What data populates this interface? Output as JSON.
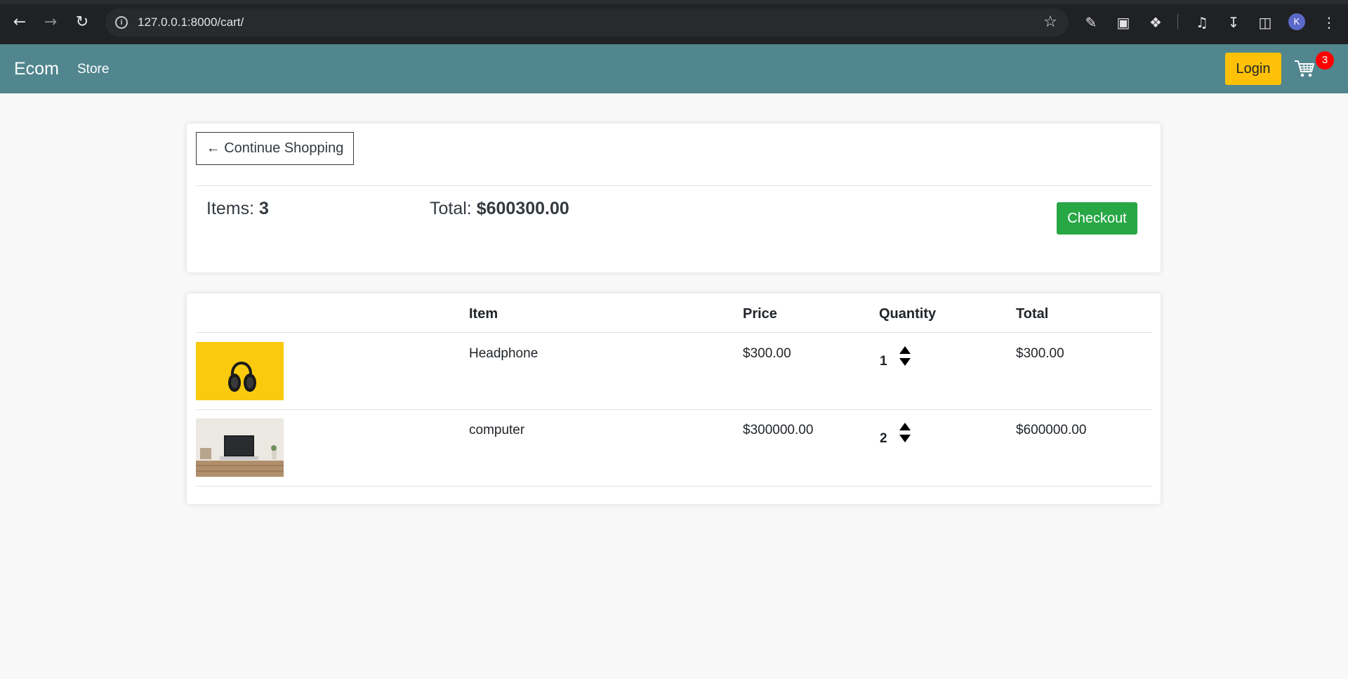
{
  "browser": {
    "url": "127.0.0.1:8000/cart/",
    "profile_initial": "K"
  },
  "navbar": {
    "brand": "Ecom",
    "store_link": "Store",
    "login_label": "Login",
    "cart_count": "3"
  },
  "summary": {
    "continue_label": "← Continue Shopping",
    "items_label": "Items: ",
    "items_value": "3",
    "total_label": "Total: ",
    "total_value": "$600300.00",
    "checkout_label": "Checkout"
  },
  "cart_table": {
    "headers": [
      "Item",
      "Price",
      "Quantity",
      "Total"
    ],
    "rows": [
      {
        "image": "headphone-image",
        "name": "Headphone",
        "price": "$300.00",
        "quantity": "1",
        "total": "$300.00"
      },
      {
        "image": "computer-image",
        "name": "computer",
        "price": "$300000.00",
        "quantity": "2",
        "total": "$600000.00"
      }
    ]
  },
  "colors": {
    "navbar": "#51868e",
    "login": "#ffc107",
    "checkout": "#28a745",
    "badge": "#ff0000"
  }
}
